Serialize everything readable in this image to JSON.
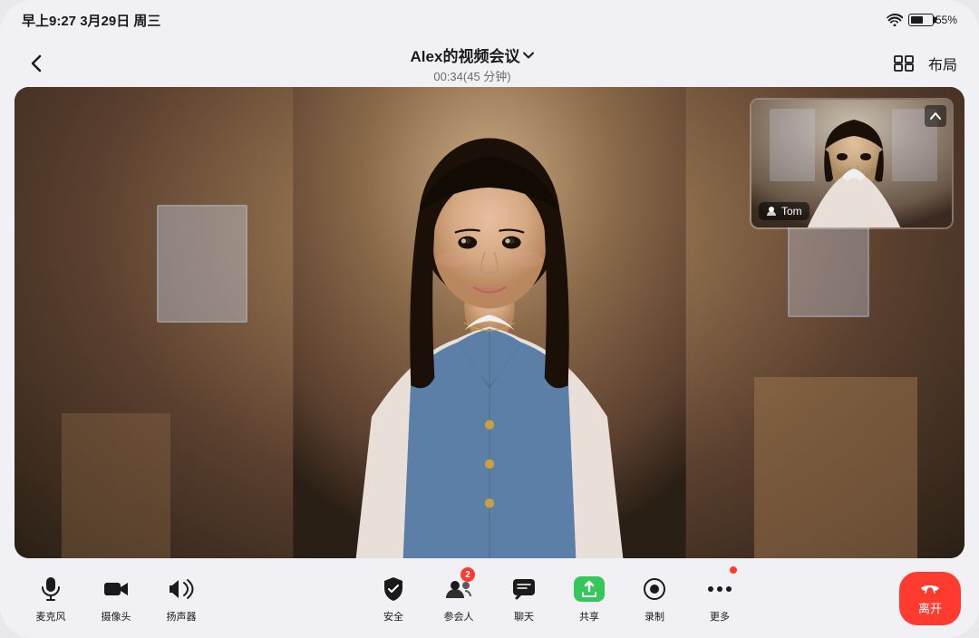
{
  "statusBar": {
    "time": "早上9:27 3月29日 周三",
    "wifi": "wifi-icon",
    "battery": "55%"
  },
  "navBar": {
    "backLabel": "‹",
    "titleMain": "Alex的视频会议",
    "titleDropdown": "▾",
    "titleSub": "00:34(45 分钟)",
    "layoutIcon": "layout-icon",
    "layoutLabel": "布局"
  },
  "thumbnail": {
    "participantName": "Tom",
    "collapseIcon": "chevron-up-icon"
  },
  "toolbar": {
    "mic": {
      "icon": "mic-icon",
      "label": "麦克风"
    },
    "camera": {
      "icon": "camera-icon",
      "label": "摄像头"
    },
    "speaker": {
      "icon": "speaker-icon",
      "label": "扬声器"
    },
    "security": {
      "icon": "security-icon",
      "label": "安全"
    },
    "participants": {
      "icon": "participants-icon",
      "label": "参会人",
      "badge": "2"
    },
    "chat": {
      "icon": "chat-icon",
      "label": "聊天"
    },
    "share": {
      "icon": "share-icon",
      "label": "共享"
    },
    "record": {
      "icon": "record-icon",
      "label": "录制"
    },
    "more": {
      "icon": "more-icon",
      "label": "更多",
      "badge": "•"
    },
    "leave": {
      "icon": "phone-down-icon",
      "label": "离开"
    }
  }
}
